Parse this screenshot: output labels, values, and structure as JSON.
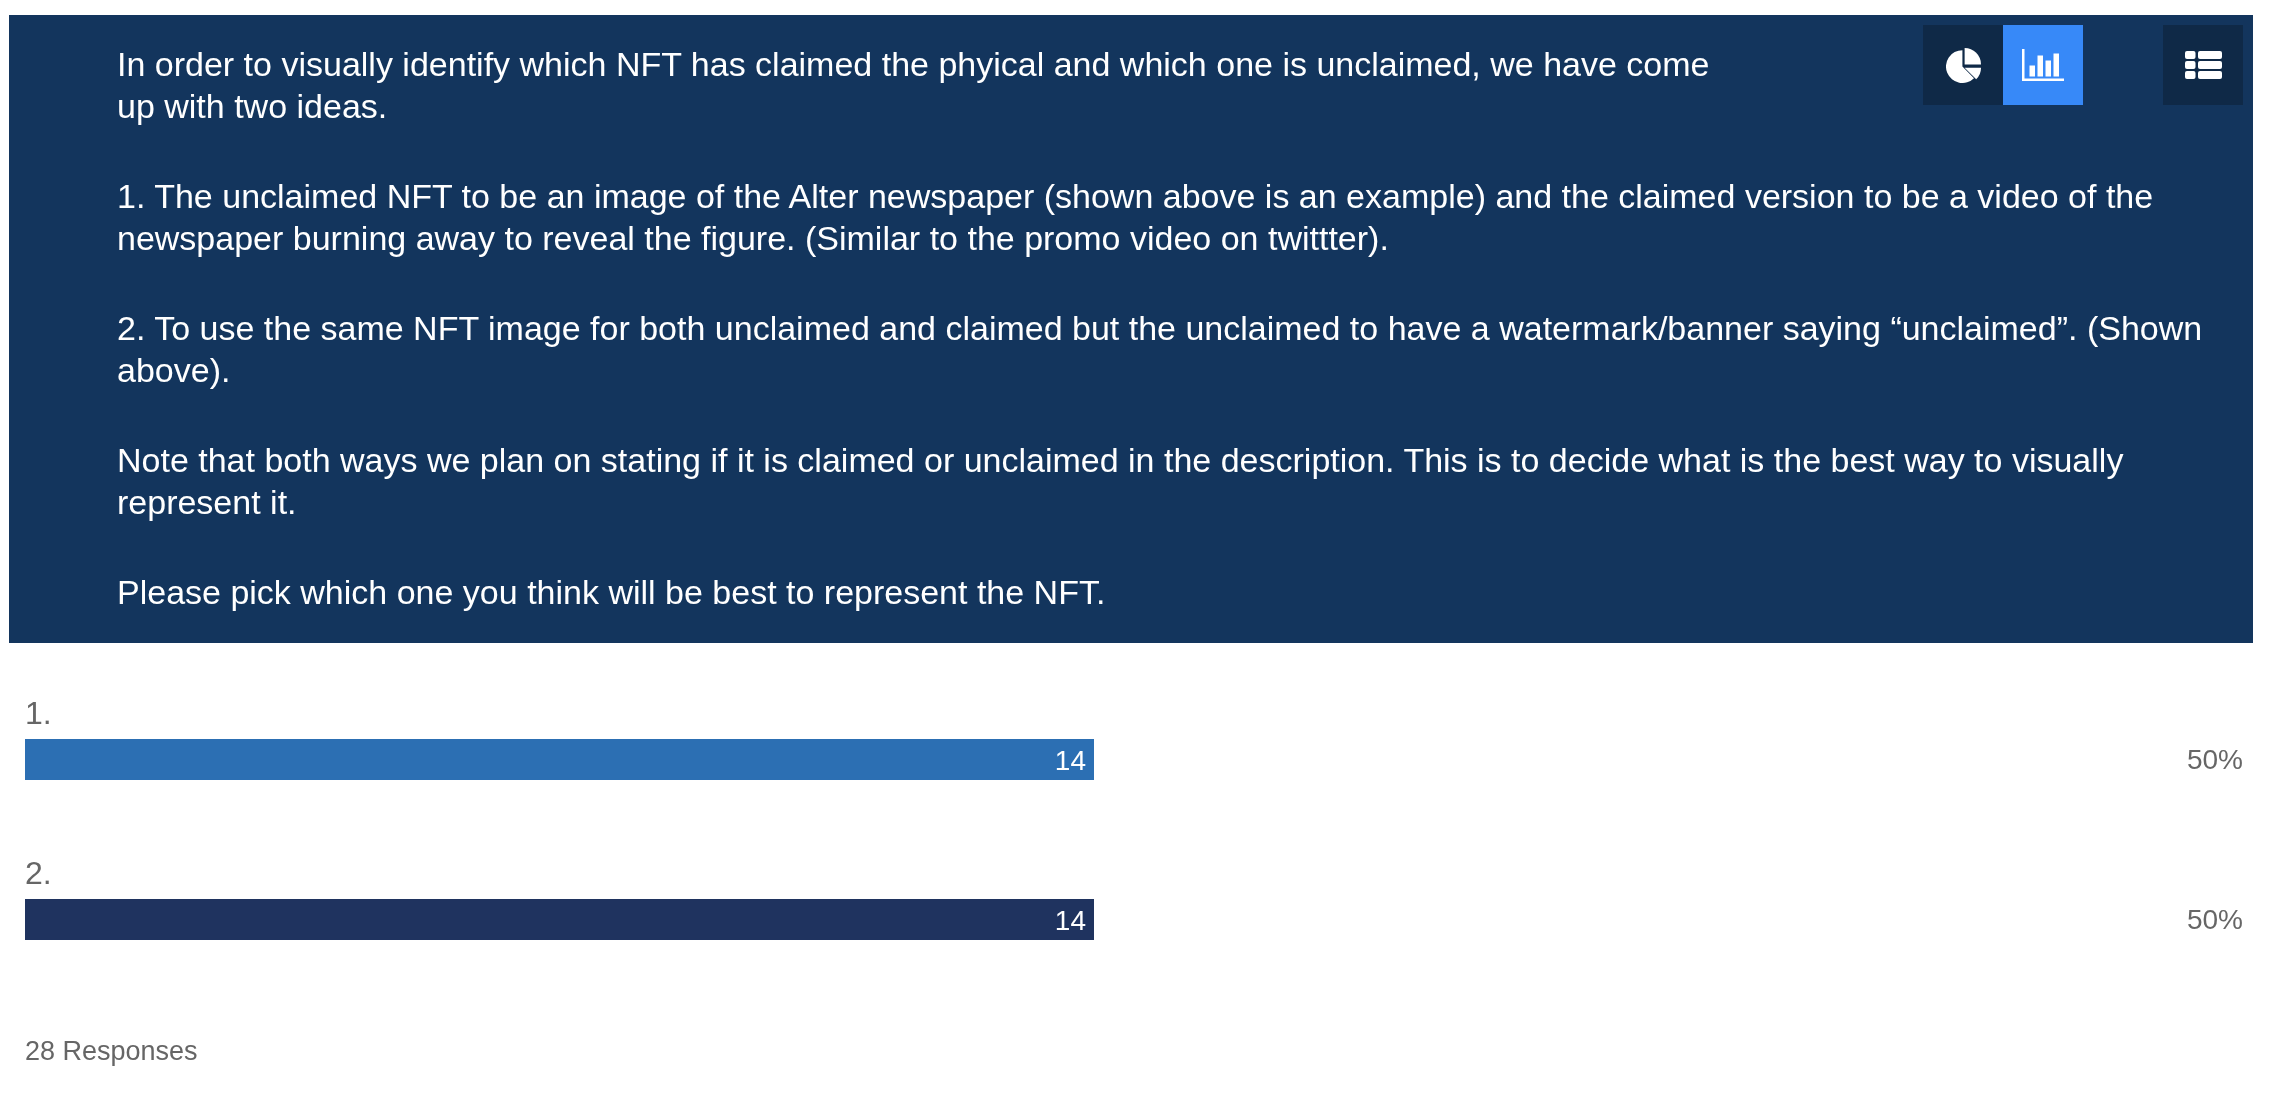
{
  "question": {
    "paragraphs": [
      "In order to visually identify which NFT has claimed the phyical and which one is unclaimed, we have come up with two ideas.",
      "1. The unclaimed NFT to be an image of the Alter newspaper (shown above is an example) and the claimed version to be a video of the newspaper burning away to reveal the figure. (Similar to the promo video on twittter).",
      "2. To use the same NFT image for both unclaimed and claimed but the unclaimed to have a watermark/banner saying “unclaimed”. (Shown above).",
      "Note that both ways we plan on stating if it is claimed or unclaimed in the description. This is to decide what is the best way to visually represent it.",
      "Please pick which one you think will be best to represent the NFT."
    ]
  },
  "chart_type_buttons": [
    {
      "selected": false
    },
    {
      "selected": true
    }
  ],
  "list_view_button": {
    "selected": false
  },
  "results": {
    "chart_data": {
      "type": "bar",
      "orientation": "horizontal",
      "categories": [
        "1.",
        "2."
      ],
      "values": [
        14,
        14
      ],
      "data_labels": true
    },
    "bars": [
      {
        "color": "#2c6fb3",
        "percent": "50%"
      },
      {
        "color": "#1f335f",
        "percent": "50%"
      }
    ]
  },
  "responses": "28 Responses"
}
